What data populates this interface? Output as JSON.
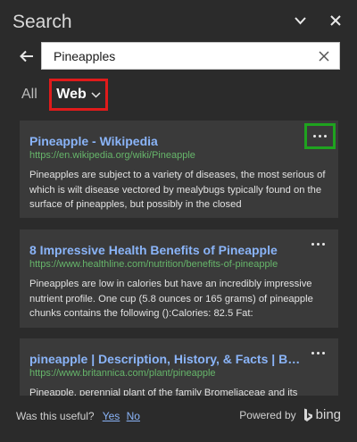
{
  "header": {
    "title": "Search",
    "collapse_icon": "chevron-down-icon",
    "close_icon": "close-icon"
  },
  "search": {
    "value": "Pineapples",
    "back_icon": "arrow-left-icon",
    "clear_icon": "clear-icon"
  },
  "scopes": {
    "all_label": "All",
    "web_label": "Web",
    "selected": "Web"
  },
  "results": [
    {
      "title": "Pineapple - Wikipedia",
      "url": "https://en.wikipedia.org/wiki/Pineapple",
      "snippet": "Pineapples are subject to a variety of diseases, the most serious of which is wilt disease vectored by mealybugs typically found on the surface of pineapples, but possibly in the closed"
    },
    {
      "title": "8 Impressive Health Benefits of Pineapple",
      "url": "https://www.healthline.com/nutrition/benefits-of-pineapple",
      "snippet": "Pineapples are low in calories but have an incredibly impressive nutrient profile. One cup (5.8 ounces or 165 grams) of pineapple chunks contains the following ():Calories: 82.5 Fat:"
    },
    {
      "title": "pineapple | Description, History, & Facts | Brita...",
      "url": "https://www.britannica.com/plant/pineapple",
      "snippet": "Pineapple, perennial plant of the family Bromeliaceae and its"
    }
  ],
  "footer": {
    "question": "Was this useful?",
    "yes": "Yes",
    "no": "No",
    "powered_by": "Powered by",
    "brand": "bing"
  },
  "colors": {
    "background": "#2b2b2b",
    "card": "#3a3a3a",
    "link": "#8ab4f8",
    "url": "#66b56a",
    "highlight_red": "#e01b1b",
    "highlight_green": "#1fa31f"
  }
}
